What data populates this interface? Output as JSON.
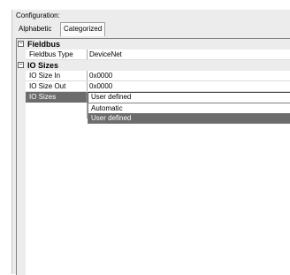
{
  "panel": {
    "title": "Configuration:"
  },
  "tabs": [
    {
      "label": "Alphabetic"
    },
    {
      "label": "Categorized"
    }
  ],
  "grid": {
    "categories": [
      {
        "label": "Fieldbus",
        "expander": "⊟"
      },
      {
        "label": "IO Sizes",
        "expander": "⊟"
      }
    ],
    "properties": [
      {
        "name": "Fieldbus Type",
        "value": "DeviceNet"
      },
      {
        "name": "IO Size In",
        "value": "0x0000"
      },
      {
        "name": "IO Size Out",
        "value": "0x0000"
      },
      {
        "name": "IO Sizes",
        "value": "User defined"
      }
    ]
  },
  "dropdown": {
    "options": [
      "Automatic",
      "User defined"
    ],
    "selected": "User defined"
  },
  "colors": {
    "selection": "#6c6c6c",
    "panel_bg": "#ececec"
  }
}
